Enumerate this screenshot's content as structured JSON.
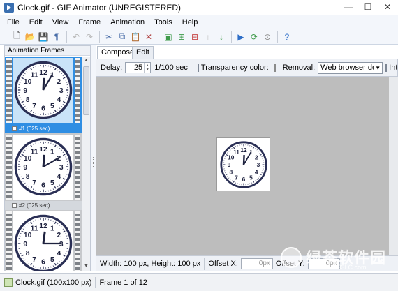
{
  "window": {
    "title": "Clock.gif - GIF Animator (UNREGISTERED)",
    "controls": [
      "—",
      "☐",
      "✕"
    ]
  },
  "menu": [
    "File",
    "Edit",
    "View",
    "Frame",
    "Animation",
    "Tools",
    "Help"
  ],
  "toolbar": [
    {
      "icon": "new-icon",
      "glyph": "🗋",
      "color": "#555"
    },
    {
      "icon": "open-icon",
      "glyph": "📂",
      "color": "#d59a2a"
    },
    {
      "icon": "save-icon",
      "glyph": "💾",
      "color": "#6a7da0"
    },
    {
      "icon": "properties-icon",
      "glyph": "¶",
      "color": "#4a6ea8"
    },
    {
      "sep": true
    },
    {
      "icon": "undo-icon",
      "glyph": "↶",
      "color": "#b8b8b8"
    },
    {
      "icon": "redo-icon",
      "glyph": "↷",
      "color": "#b8b8b8"
    },
    {
      "sep": true
    },
    {
      "icon": "cut-icon",
      "glyph": "✂",
      "color": "#4a6ea8"
    },
    {
      "icon": "copy-icon",
      "glyph": "⧉",
      "color": "#4a6ea8"
    },
    {
      "icon": "paste-icon",
      "glyph": "📋",
      "color": "#9a7a40"
    },
    {
      "icon": "delete-icon",
      "glyph": "✕",
      "color": "#b04040"
    },
    {
      "sep": true
    },
    {
      "icon": "insert-frame-icon",
      "glyph": "▣",
      "color": "#3e9a4a"
    },
    {
      "icon": "add-frame-icon",
      "glyph": "⊞",
      "color": "#3e9a4a"
    },
    {
      "icon": "remove-frame-icon",
      "glyph": "⊟",
      "color": "#c84a4a"
    },
    {
      "icon": "move-up-icon",
      "glyph": "↑",
      "color": "#b8b8b8"
    },
    {
      "icon": "move-down-icon",
      "glyph": "↓",
      "color": "#3e9a4a"
    },
    {
      "sep": true
    },
    {
      "icon": "play-icon",
      "glyph": "▶",
      "color": "#2f6fc8"
    },
    {
      "icon": "loop-icon",
      "glyph": "⟳",
      "color": "#3e9a4a"
    },
    {
      "icon": "stop-icon",
      "glyph": "⊙",
      "color": "#888"
    },
    {
      "sep": true
    },
    {
      "icon": "help-icon",
      "glyph": "?",
      "color": "#2f6fc8"
    }
  ],
  "left_panel": {
    "title": "Animation Frames",
    "frames": [
      {
        "caption": "#1 (025 sec)",
        "selected": true,
        "hour": 12,
        "minute": 5
      },
      {
        "caption": "#2 (025 sec)",
        "selected": false,
        "hour": 12,
        "minute": 10
      },
      {
        "caption": "",
        "selected": false,
        "hour": 12,
        "minute": 15
      }
    ]
  },
  "tabs": [
    {
      "label": "Compose",
      "active": true
    },
    {
      "label": "Edit",
      "active": false
    }
  ],
  "props": {
    "delay_label": "Delay:",
    "delay_value": "25",
    "delay_unit": "1/100 sec",
    "transparency_label": "Transparency color:",
    "transparency_color": "#a0a0a0",
    "removal_label": "Removal:",
    "removal_value": "Web browser de",
    "interlaced_label": "Int"
  },
  "canvas": {
    "background": "#bdbdbd",
    "clock_hour": 12,
    "clock_minute": 5
  },
  "info": {
    "size_text": "Width: 100 px, Height: 100 px",
    "offset_x_label": "Offset X:",
    "offset_x_value": "0px",
    "offset_y_label": "Offset Y:",
    "offset_y_value": "0px"
  },
  "status": {
    "file": "Clock.gif (100x100 px)",
    "frame": "Frame 1 of 12"
  },
  "watermark": {
    "text": "绿茶软件园",
    "url": "www.33LC.com"
  }
}
